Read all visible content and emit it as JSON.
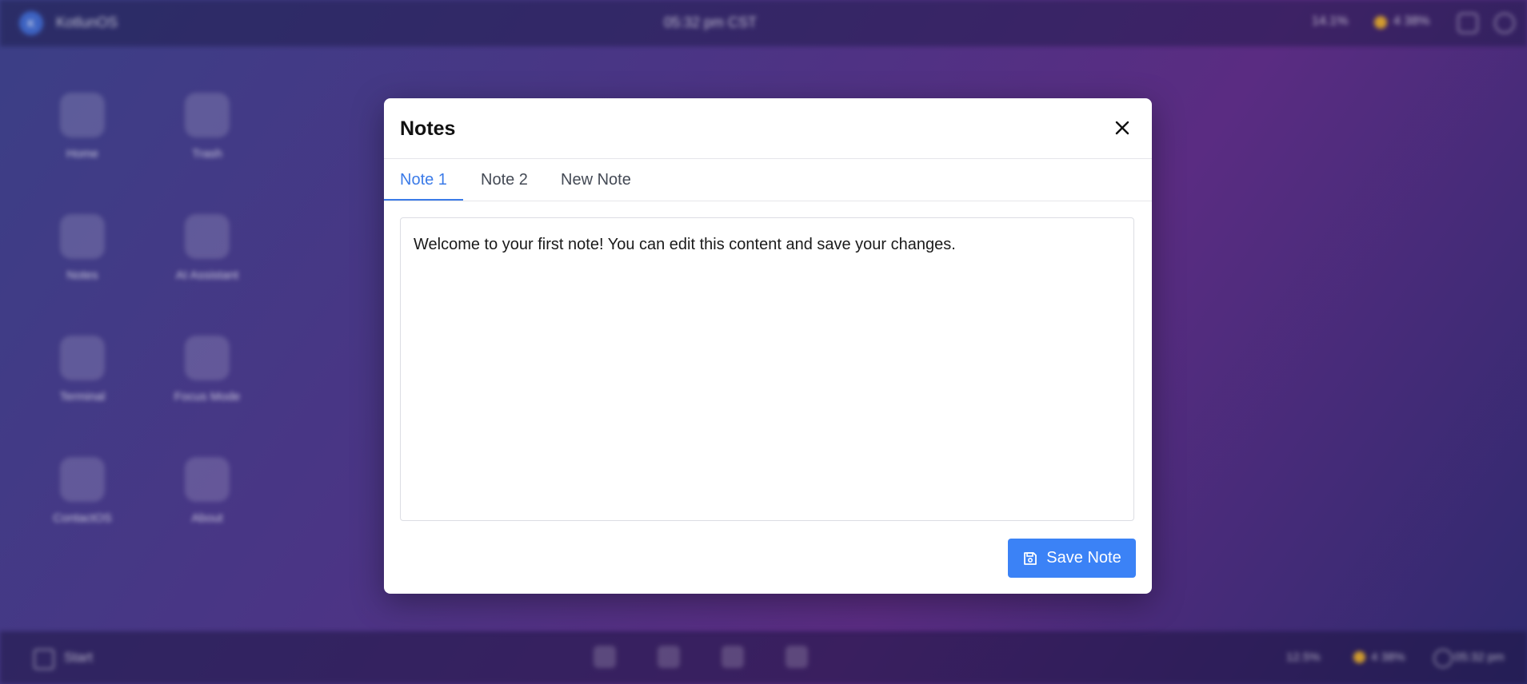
{
  "desktop": {
    "topbar": {
      "logo_letter": "K",
      "os_name": "KotlunOS",
      "clock": "05:32 pm CST",
      "cpu": "14.1%",
      "battery": "4 38%"
    },
    "icons": [
      {
        "label": "Home"
      },
      {
        "label": "Trash"
      },
      {
        "label": "Notes"
      },
      {
        "label": "AI Assistant"
      },
      {
        "label": "Terminal"
      },
      {
        "label": "Focus Mode"
      },
      {
        "label": "ContactOS"
      },
      {
        "label": "About"
      }
    ],
    "taskbar": {
      "start_label": "Start",
      "cpu": "12.5%",
      "battery": "4 38%",
      "clock": "05:32 pm"
    }
  },
  "dialog": {
    "title": "Notes",
    "tabs": [
      {
        "label": "Note 1",
        "active": true
      },
      {
        "label": "Note 2",
        "active": false
      },
      {
        "label": "New Note",
        "active": false
      }
    ],
    "editor_content": "Welcome to your first note! You can edit this content and save your changes.",
    "save_label": "Save Note"
  },
  "colors": {
    "accent": "#3b82f6",
    "tab_active": "#3b7be8"
  }
}
